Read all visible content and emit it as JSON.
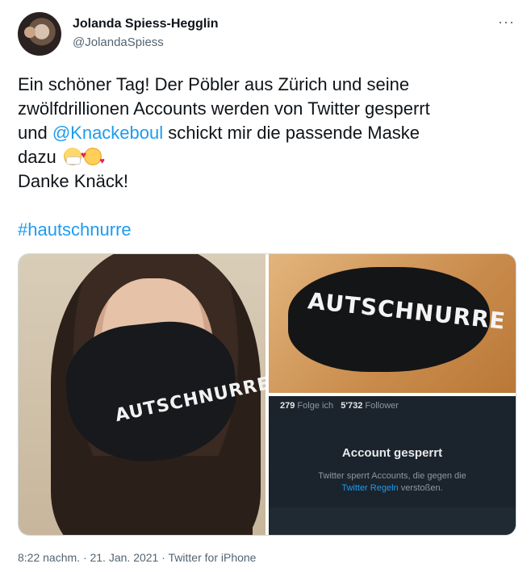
{
  "author": {
    "name": "Jolanda Spiess-Hegglin",
    "handle": "@JolandaSpiess"
  },
  "menu": {
    "more": "···"
  },
  "tweet": {
    "line1": "Ein schöner Tag! Der Pöbler aus Zürich und seine",
    "line2": "zwölfdrillionen Accounts werden von Twitter gesperrt",
    "line3_a": "und ",
    "mention": "@Knackeboul",
    "line3_b": " schickt mir die passende Maske",
    "line4": "dazu",
    "line5": "Danke Knäck!",
    "hashtag": "#hautschnurre"
  },
  "emoji": {
    "first": "face-with-medical-mask",
    "second": "smiling-face-with-hearts"
  },
  "media": {
    "left": {
      "mask_text": "AUTSCHNURRE"
    },
    "top_right": {
      "mask_text": "AUTSCHNURRE"
    },
    "bottom_right": {
      "following_count": "279",
      "following_label": "Folge ich",
      "followers_count": "5'732",
      "followers_label": "Follower",
      "title": "Account gesperrt",
      "desc_line1": "Twitter sperrt Accounts, die gegen die",
      "desc_link": "Twitter Regeln",
      "desc_line2_b": " verstoßen."
    }
  },
  "footer": {
    "meta": "8:22 nachm. · 21. Jan. 2021 · Twitter for iPhone"
  },
  "colors": {
    "link": "#1d9bf0",
    "secondary": "#536471"
  }
}
